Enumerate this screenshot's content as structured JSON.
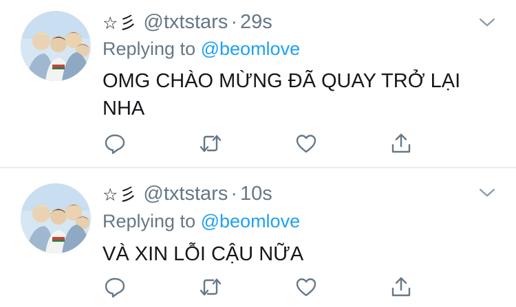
{
  "colors": {
    "text": "#14171a",
    "secondary": "#657786",
    "link": "#1da1f2",
    "divider": "#e6ecf0"
  },
  "tweets": [
    {
      "display_name": "☆彡",
      "handle": "@txtstars",
      "separator": "·",
      "time": "29s",
      "replying_prefix": "Replying to",
      "replying_to": "@beomlove",
      "text": "OMG CHÀO MỪNG ĐÃ QUAY TRỞ LẠI NHA"
    },
    {
      "display_name": "☆彡",
      "handle": "@txtstars",
      "separator": "·",
      "time": "10s",
      "replying_prefix": "Replying to",
      "replying_to": "@beomlove",
      "text": "VÀ XIN LỖI CẬU NỮA"
    }
  ],
  "icons": [
    "chevron-down-icon",
    "reply-icon",
    "retweet-icon",
    "like-icon",
    "share-icon"
  ]
}
